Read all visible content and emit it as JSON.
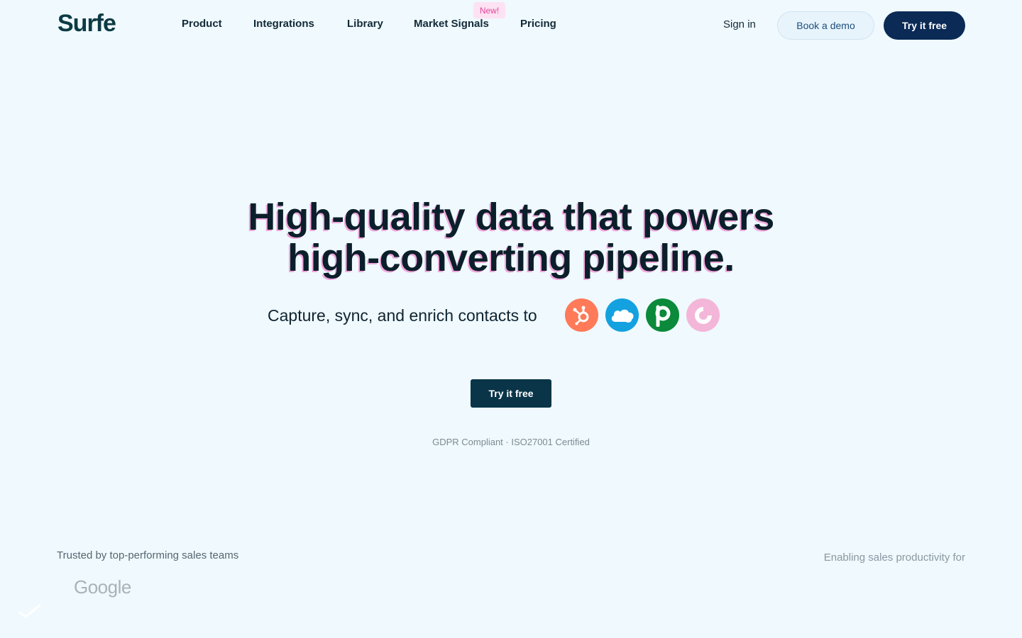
{
  "header": {
    "logo": "Surfe",
    "nav": [
      {
        "label": "Product"
      },
      {
        "label": "Integrations"
      },
      {
        "label": "Library"
      },
      {
        "label": "Market Signals",
        "badge": "New!"
      },
      {
        "label": "Pricing"
      }
    ],
    "sign_in": "Sign in",
    "book_demo": "Book a demo",
    "try_free": "Try it free"
  },
  "hero": {
    "title_line1": "High-quality data that powers",
    "title_line2": "high-converting pipeline.",
    "subtitle": "Capture, sync, and enrich contacts to",
    "crm_icons": [
      "hubspot-icon",
      "salesforce-icon",
      "pipedrive-icon",
      "copper-icon"
    ],
    "cta": "Try it free",
    "compliance": "GDPR Compliant · ISO27001 Certified"
  },
  "footer": {
    "trusted": "Trusted by top-performing sales teams",
    "enabling": "Enabling sales productivity for",
    "customer_logo": "Google"
  },
  "colors": {
    "background": "#eff9fe",
    "primary_dark": "#0b2a55",
    "cta_dark": "#0a3548",
    "accent_pink": "#f0a6dc"
  }
}
